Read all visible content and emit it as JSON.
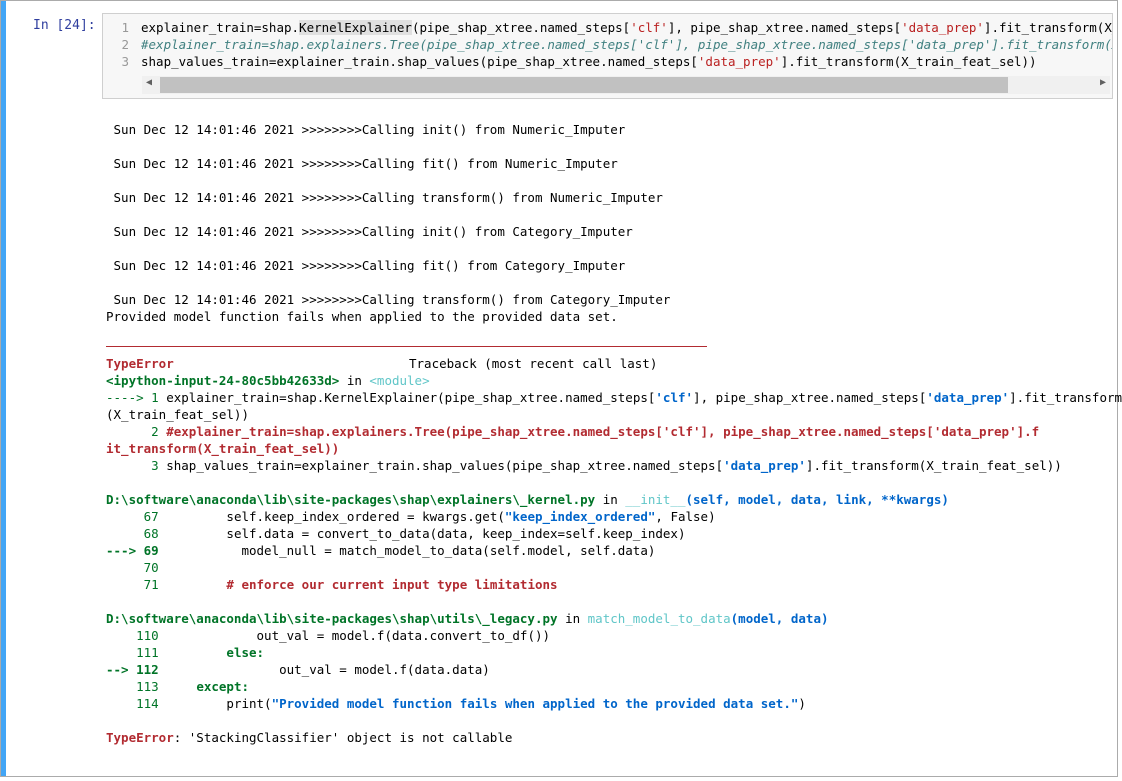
{
  "prompt": "In  [24]:",
  "input_lines": [
    {
      "num": "1",
      "pre": "explainer_train=shap.",
      "hl": "KernelExplainer",
      "mid": "(pipe_shap_xtree.named_steps[",
      "s1": "'clf'",
      "mid2": "], pipe_shap_xtree.named_steps[",
      "s2": "'data_prep'",
      "post": "].fit_transform(X_train_fe"
    },
    {
      "num": "2",
      "comment": "#explainer_train=shap.explainers.Tree(pipe_shap_xtree.named_steps['clf'], pipe_shap_xtree.named_steps['data_prep'].fit_transform(X_train_f"
    },
    {
      "num": "3",
      "pre": "shap_values_train=explainer_train.shap_values(pipe_shap_xtree.named_steps[",
      "s1": "'data_prep'",
      "post": "].fit_transform(X_train_feat_sel))"
    }
  ],
  "stdout": [
    " Sun Dec 12 14:01:46 2021 >>>>>>>>Calling init() from Numeric_Imputer",
    " Sun Dec 12 14:01:46 2021 >>>>>>>>Calling fit() from Numeric_Imputer",
    " Sun Dec 12 14:01:46 2021 >>>>>>>>Calling transform() from Numeric_Imputer",
    " Sun Dec 12 14:01:46 2021 >>>>>>>>Calling init() from Category_Imputer",
    " Sun Dec 12 14:01:46 2021 >>>>>>>>Calling fit() from Category_Imputer",
    " Sun Dec 12 14:01:46 2021 >>>>>>>>Calling transform() from Category_Imputer",
    "Provided model function fails when applied to the provided data set."
  ],
  "traceback": {
    "error_name": "TypeError",
    "header_right": "Traceback (most recent call last)",
    "input_ref": "<ipython-input-24-80c5bb42633d>",
    "in_word": " in ",
    "module": "<module>",
    "frame1": [
      {
        "arrow": "---->",
        "num": " 1",
        "text1": " explainer_train=shap.KernelExplainer(pipe_shap_xtree.named_steps[",
        "s1": "'clf'",
        "text2": "], pipe_shap_xtree.named_steps[",
        "s2": "'data_prep'",
        "text3": "].fit_transform"
      },
      {
        "wrap": "(X_train_feat_sel))"
      },
      {
        "num": "      2",
        "comment": " #explainer_train=shap.explainers.Tree(pipe_shap_xtree.named_steps['clf'], pipe_shap_xtree.named_steps['data_prep'].f"
      },
      {
        "comment_wrap": "it_transform(X_train_feat_sel))"
      },
      {
        "num": "      3",
        "text1": " shap_values_train=explainer_train.shap_values(pipe_shap_xtree.named_steps[",
        "s1": "'data_prep'",
        "text3": "].fit_transform(X_train_feat_sel))"
      }
    ],
    "file1": "D:\\software\\anaconda\\lib\\site-packages\\shap\\explainers\\_kernel.py",
    "func1": "__init__",
    "args1": "(self, model, data, link, **kwargs)",
    "frame2": [
      {
        "num": "     67",
        "text": "         self.keep_index_ordered = kwargs.get(",
        "s": "\"keep_index_ordered\"",
        "tail": ", False)"
      },
      {
        "num": "     68",
        "text": "         self.data = convert_to_data(data, keep_index=self.keep_index)"
      },
      {
        "arrow": "---> 69",
        "text": "           model_null = match_model_to_data(self.model, self.data)"
      },
      {
        "num": "     70",
        "text": ""
      },
      {
        "num": "     71",
        "comment": "         # enforce our current input type limitations"
      }
    ],
    "file2": "D:\\software\\anaconda\\lib\\site-packages\\shap\\utils\\_legacy.py",
    "func2": "match_model_to_data",
    "args2": "(model, data)",
    "frame3": [
      {
        "num": "    110",
        "text": "             out_val = model.f(data.convert_to_df())"
      },
      {
        "num": "    111",
        "kw": "         else:"
      },
      {
        "arrow": "--> 112",
        "text": "                out_val = model.f(data.data)"
      },
      {
        "num": "    113",
        "kw": "     except:"
      },
      {
        "num": "    114",
        "text": "         print(",
        "s": "\"Provided model function fails when applied to the provided data set.\"",
        "tail": ")"
      }
    ],
    "final_error": "TypeError",
    "final_msg": ": 'StackingClassifier' object is not callable"
  }
}
